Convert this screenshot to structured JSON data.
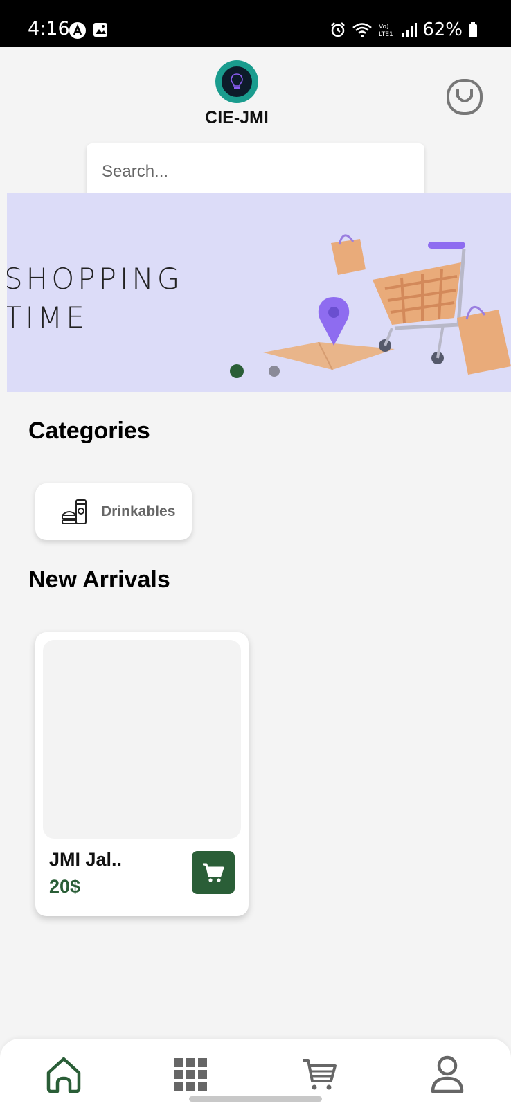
{
  "status_bar": {
    "time": "4:16",
    "battery": "62%"
  },
  "header": {
    "brand": "CIE-JMI"
  },
  "search": {
    "placeholder": "Search..."
  },
  "banner": {
    "line1": "SHOPPING",
    "line2": "TIME",
    "slides": 2,
    "active_slide": 1
  },
  "categories": {
    "title": "Categories",
    "items": [
      {
        "label": "Drinkables",
        "icon": "food-drink-icon"
      }
    ]
  },
  "new_arrivals": {
    "title": "New Arrivals",
    "products": [
      {
        "name": "JMI Jal..",
        "price": "20$"
      }
    ]
  },
  "bottom_nav": {
    "items": [
      {
        "icon": "home-icon",
        "active": true
      },
      {
        "icon": "grid-icon",
        "active": false
      },
      {
        "icon": "cart-icon",
        "active": false
      },
      {
        "icon": "user-icon",
        "active": false
      }
    ]
  },
  "colors": {
    "accent": "#2a5e37",
    "background": "#f4f4f4",
    "banner": "#dcdcf8",
    "nav_inactive": "#666666"
  }
}
